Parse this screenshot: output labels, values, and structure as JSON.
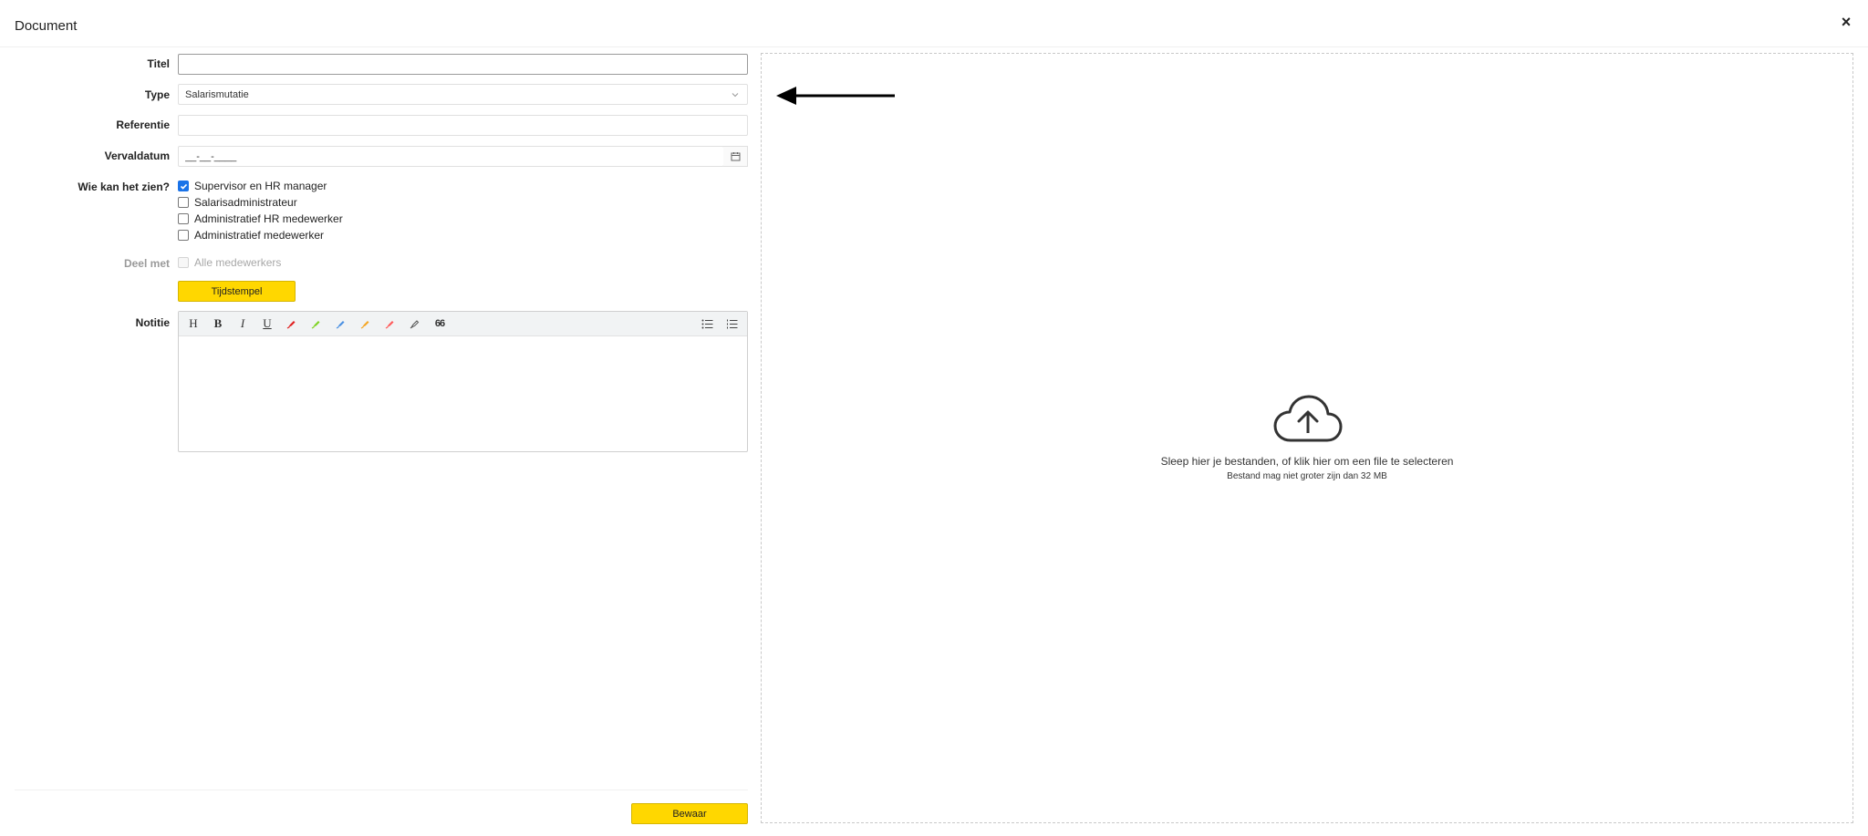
{
  "dialog": {
    "title": "Document",
    "close_label": "×"
  },
  "form": {
    "title_label": "Titel",
    "title_value": "",
    "type_label": "Type",
    "type_value": "Salarismutatie",
    "reference_label": "Referentie",
    "reference_value": "",
    "due_label": "Vervaldatum",
    "due_value": "__-__-____",
    "visibility_label": "Wie kan het zien?",
    "visibility_options": [
      {
        "label": "Supervisor en HR manager",
        "checked": true
      },
      {
        "label": "Salarisadministrateur",
        "checked": false
      },
      {
        "label": "Administratief HR medewerker",
        "checked": false
      },
      {
        "label": "Administratief medewerker",
        "checked": false
      }
    ],
    "share_label": "Deel met",
    "share_option": {
      "label": "Alle medewerkers",
      "checked": false,
      "disabled": true
    },
    "timestamp_button": "Tijdstempel",
    "note_label": "Notitie",
    "save_button": "Bewaar"
  },
  "toolbar": {
    "heading": "H",
    "bold": "B",
    "italic": "I",
    "underline": "U",
    "quote": "66",
    "marker_colors": [
      "#e02020",
      "#7ed321",
      "#4a90e2",
      "#f5a623",
      "#ff5a5a"
    ]
  },
  "upload": {
    "instruction": "Sleep hier je bestanden, of klik hier om een file te selecteren",
    "limit": "Bestand mag niet groter zijn dan 32 MB"
  }
}
